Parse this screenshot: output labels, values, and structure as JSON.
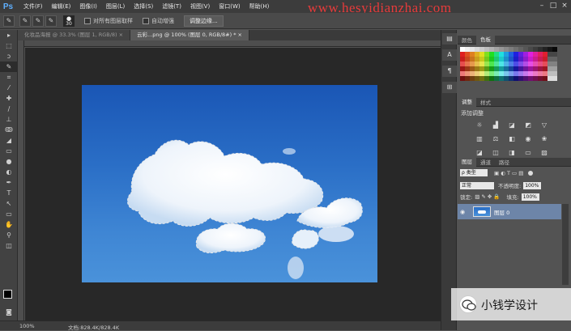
{
  "app": {
    "logo": "Ps",
    "watermark": "www.hesyidianzhai.com"
  },
  "menu": [
    "文件(F)",
    "编辑(E)",
    "图像(I)",
    "图层(L)",
    "选择(S)",
    "滤镜(T)",
    "视图(V)",
    "窗口(W)",
    "帮助(H)"
  ],
  "options": {
    "brush_size": "30",
    "sample_all_layers": "对所有图层取样",
    "auto_enhance": "自动增强",
    "refine_edge": "调整边缘..."
  },
  "tabs": [
    {
      "label": "化妆品海报 @ 33.3% (图层 1, RGB/8) ×"
    },
    {
      "label": "云彩...png @ 100% (图层 0, RGB/8#) * ×"
    }
  ],
  "status": {
    "zoom": "100%",
    "doc": "文档:828.4K/828.4K"
  },
  "panels": {
    "color_tabs": [
      "颜色",
      "色板"
    ],
    "adjust_tabs": [
      "调整",
      "样式"
    ],
    "adjust_title": "添加调整",
    "layers_tabs": [
      "图层",
      "通道",
      "路径"
    ],
    "kind_select": "ρ 类型",
    "blend_mode": "正常",
    "opacity_label": "不透明度:",
    "opacity_value": "100%",
    "lock_label": "锁定:",
    "fill_label": "填充:",
    "fill_value": "100%",
    "layer_name": "图层 0"
  },
  "brand": {
    "wechat_name": "小钱学设计"
  }
}
